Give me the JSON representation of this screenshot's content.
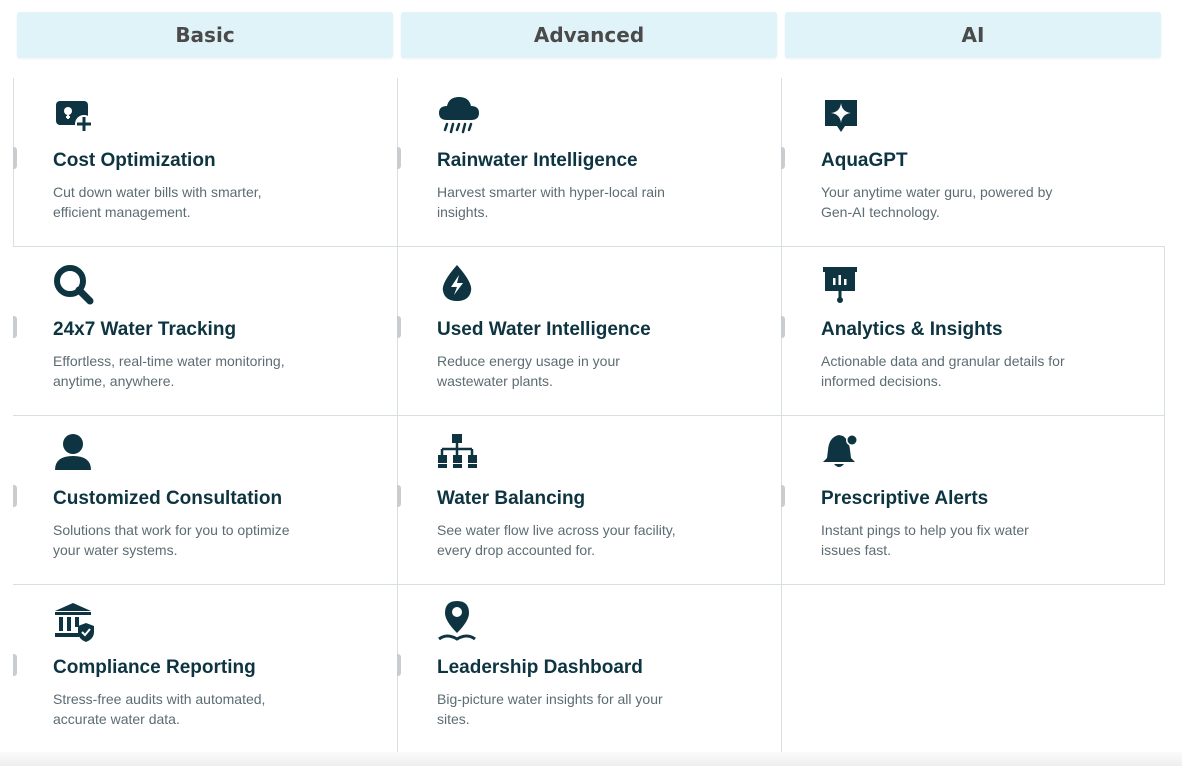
{
  "tabs": [
    {
      "label": "Basic"
    },
    {
      "label": "Advanced"
    },
    {
      "label": "AI"
    }
  ],
  "columns": [
    {
      "cards": [
        {
          "icon": "cost-plus-icon",
          "title": "Cost Optimization",
          "desc": "Cut down water bills with smarter, efficient management."
        },
        {
          "icon": "magnifier-icon",
          "title": "24x7 Water Tracking",
          "desc": "Effortless, real-time water monitoring, anytime, anywhere."
        },
        {
          "icon": "user-icon",
          "title": "Customized Consultation",
          "desc": "Solutions that work for you to optimize your water systems."
        },
        {
          "icon": "bank-shield-icon",
          "title": "Compliance Reporting",
          "desc": "Stress-free audits with automated, accurate water data."
        }
      ]
    },
    {
      "cards": [
        {
          "icon": "rain-cloud-icon",
          "title": "Rainwater Intelligence",
          "desc": "Harvest smarter with hyper-local rain insights."
        },
        {
          "icon": "drop-bolt-icon",
          "title": "Used Water Intelligence",
          "desc": "Reduce energy usage in your wastewater plants."
        },
        {
          "icon": "sitemap-icon",
          "title": "Water Balancing",
          "desc": "See water flow live across your facility, every drop accounted for."
        },
        {
          "icon": "map-pin-icon",
          "title": "Leadership Dashboard",
          "desc": "Big-picture water insights for all your sites."
        }
      ]
    },
    {
      "cards": [
        {
          "icon": "sparkle-chat-icon",
          "title": "AquaGPT",
          "desc": "Your anytime water guru, powered by Gen-AI technology."
        },
        {
          "icon": "presentation-chart-icon",
          "title": "Analytics & Insights",
          "desc": "Actionable data and granular details for informed decisions."
        },
        {
          "icon": "bell-alert-icon",
          "title": "Prescriptive Alerts",
          "desc": "Instant pings to help you fix water issues fast."
        }
      ]
    }
  ],
  "colors": {
    "tab_bg": "#dff3f8",
    "icon": "#0d3440",
    "title": "#0d3440",
    "desc": "#5c6c73",
    "border": "#d9dee0"
  }
}
